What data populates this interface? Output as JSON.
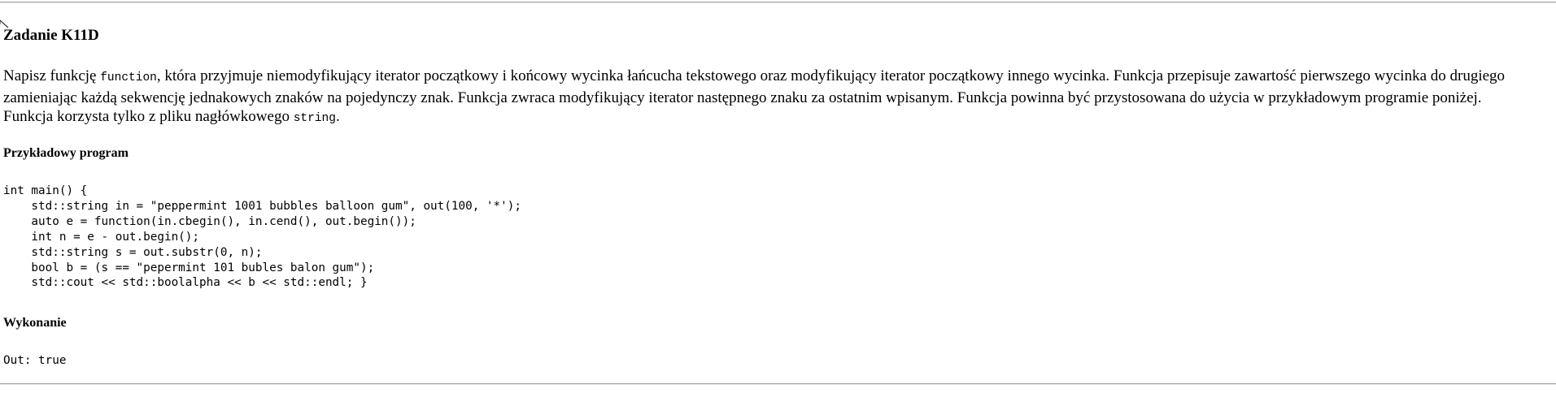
{
  "task": {
    "title": "Zadanie K11D",
    "description": {
      "before_code1": "Napisz funkcję ",
      "code1": "function",
      "middle": ", która przyjmuje niemodyfikujący iterator początkowy i końcowy wycinka łańcucha tekstowego oraz modyfikujący iterator początkowy innego wycinka. Funkcja przepisuje zawartość pierwszego wycinka do drugiego zamieniając każdą sekwencję jednakowych znaków na pojedynczy znak. Funkcja zwraca modyfikujący iterator następnego znaku za ostatnim wpisanym. Funkcja powinna być przystosowana do użycia w przykładowym programie poniżej. Funkcja korzysta tylko z pliku nagłówkowego ",
      "code2": "string",
      "after_code2": "."
    }
  },
  "example_program": {
    "heading": "Przykładowy program",
    "code": "int main() {\n    std::string in = \"peppermint 1001 bubbles balloon gum\", out(100, '*');\n    auto e = function(in.cbegin(), in.cend(), out.begin());\n    int n = e - out.begin();\n    std::string s = out.substr(0, n);\n    bool b = (s == \"pepermint 101 bubles balon gum\");\n    std::cout << std::boolalpha << b << std::endl; }"
  },
  "execution": {
    "heading": "Wykonanie",
    "output": "Out: true"
  }
}
